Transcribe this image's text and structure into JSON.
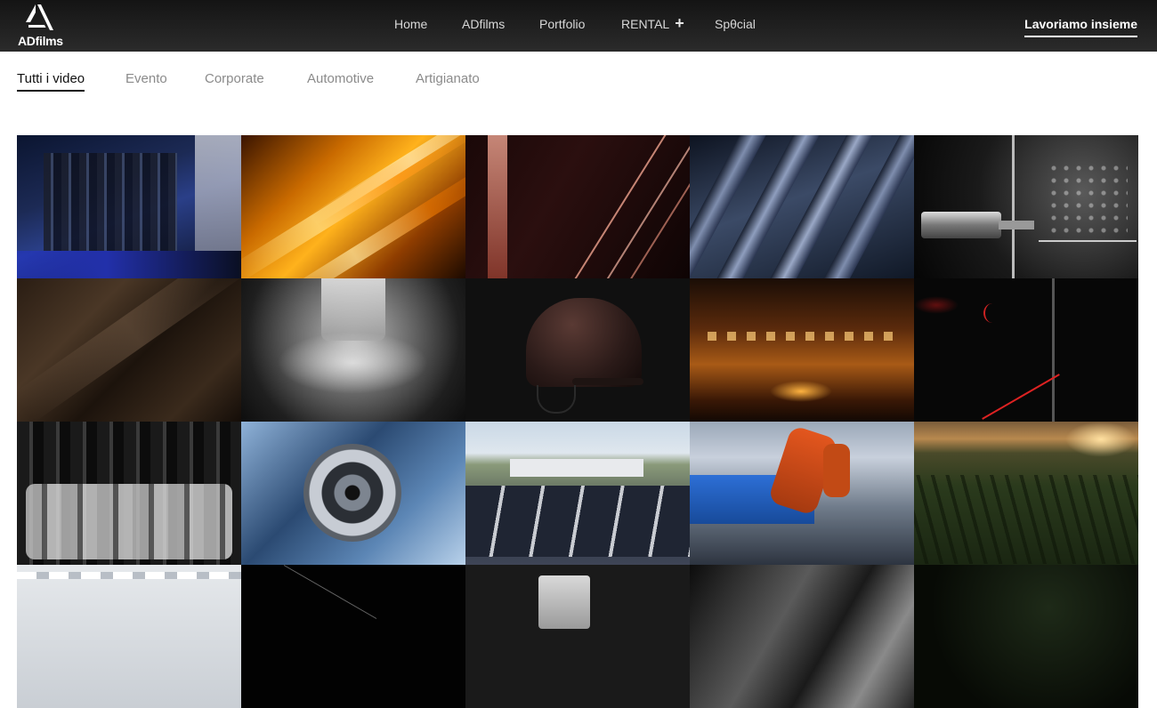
{
  "brand": {
    "logo_text": "ADfilms",
    "logo_icon": "adfilms-triangle-logo"
  },
  "nav": {
    "items": [
      {
        "label": "Home"
      },
      {
        "label": "ADfilms"
      },
      {
        "label": "Portfolio"
      },
      {
        "label": "RENTAL",
        "has_expand": true,
        "expand_icon": "plus-icon"
      },
      {
        "label": "Spθcial"
      }
    ],
    "cta": "Lavoriamo insieme"
  },
  "filters": {
    "items": [
      "Tutti i video",
      "Evento",
      "Corporate",
      "Automotive",
      "Artigianato"
    ],
    "active": "Tutti i video"
  },
  "videos": [
    {
      "subject": "lab-machinery-blue"
    },
    {
      "subject": "amber-glass-tubes"
    },
    {
      "subject": "copper-light-streaks"
    },
    {
      "subject": "steel-ridges"
    },
    {
      "subject": "faucet-water-droplets"
    },
    {
      "subject": "leather-texture"
    },
    {
      "subject": "crystal-glass-light"
    },
    {
      "subject": "riding-helmet"
    },
    {
      "subject": "amber-liquid-glass"
    },
    {
      "subject": "red-light-dark"
    },
    {
      "subject": "glass-ice-shapes"
    },
    {
      "subject": "turbine-engine"
    },
    {
      "subject": "solar-carport-aerial"
    },
    {
      "subject": "industrial-robot-arm"
    },
    {
      "subject": "vineyard-sunset"
    },
    {
      "subject": "cleanroom-lights"
    },
    {
      "subject": "dark-line"
    },
    {
      "subject": "metal-box-product"
    },
    {
      "subject": "metal-parts-bw"
    },
    {
      "subject": "dark-foliage"
    }
  ]
}
